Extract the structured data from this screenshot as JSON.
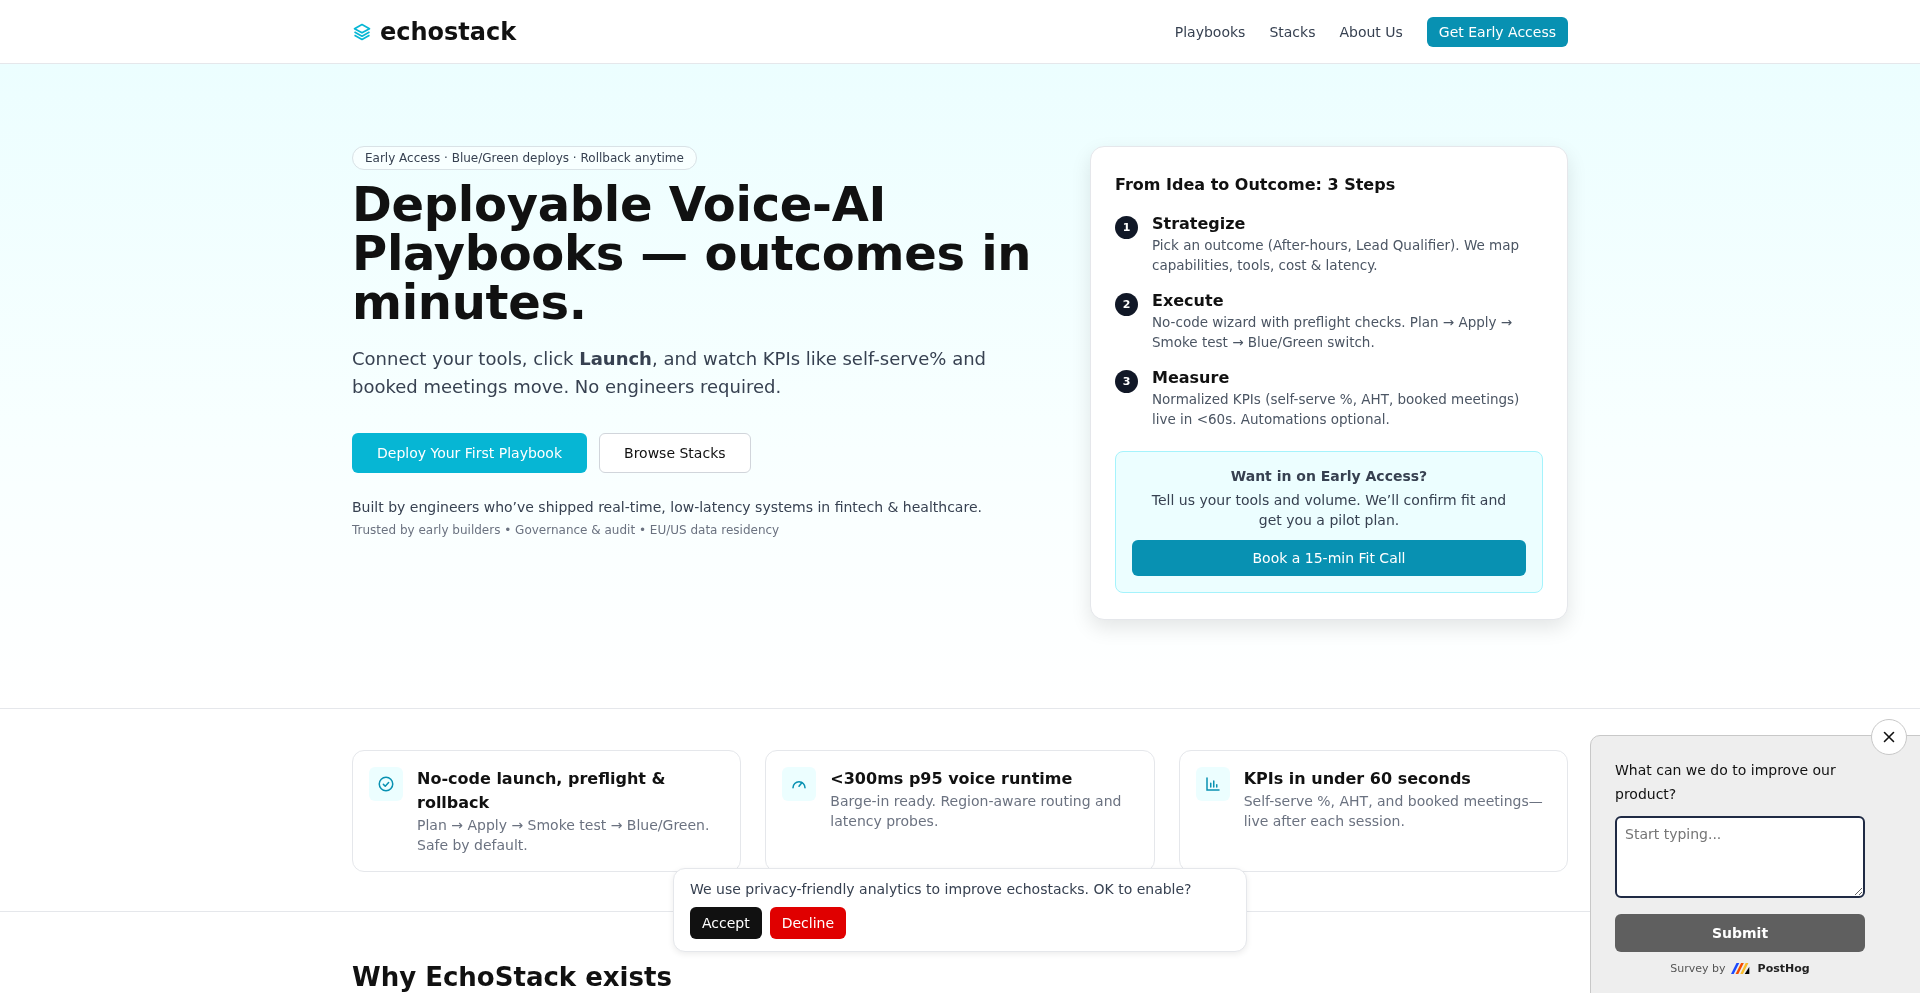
{
  "header": {
    "brand": "echostack",
    "nav": [
      {
        "label": "Playbooks",
        "kind": "link"
      },
      {
        "label": "Stacks",
        "kind": "link"
      },
      {
        "label": "About Us",
        "kind": "link"
      },
      {
        "label": "Get Early Access",
        "kind": "cta"
      }
    ]
  },
  "hero": {
    "badge": "Early Access · Blue/Green deploys · Rollback anytime",
    "title": "Deployable Voice-AI Playbooks — outcomes in minutes.",
    "lead": "Connect your tools, click **Launch**, and watch KPIs like self-serve% and booked meetings move. No engineers required.",
    "buttons": [
      {
        "label": "Deploy Your First Playbook",
        "kind": "primary"
      },
      {
        "label": "Browse Stacks",
        "kind": "secondary"
      }
    ],
    "note": "Built by engineers who’ve shipped real-time, low-latency systems in fintech & healthcare.",
    "trust": "Trusted by early builders • Governance & audit • EU/US data residency"
  },
  "steps_card": {
    "title": "From Idea to Outcome: 3 Steps",
    "steps": [
      {
        "number": "1",
        "title": "Strategize",
        "text": "Pick an outcome (After-hours, Lead Qualifier). We map capabilities, tools, cost & latency."
      },
      {
        "number": "2",
        "title": "Execute",
        "text": "No-code wizard with preflight checks. Plan → Apply → Smoke test → Blue/Green switch."
      },
      {
        "number": "3",
        "title": "Measure",
        "text": "Normalized KPIs (self-serve %, AHT, booked meetings) live in <60s. Automations optional."
      }
    ],
    "callout": {
      "title": "Want in on Early Access?",
      "text": "Tell us your tools and volume. We’ll confirm fit and get you a pilot plan.",
      "button": "Book a 15-min Fit Call"
    }
  },
  "features": [
    {
      "kind": "check",
      "title": "No-code launch, preflight & rollback",
      "text": "Plan → Apply → Smoke test → Blue/Green. Safe by default."
    },
    {
      "kind": "gauge",
      "title": "<300ms p95 voice runtime",
      "text": "Barge-in ready. Region-aware routing and latency probes."
    },
    {
      "kind": "chart",
      "title": "KPIs in under 60 seconds",
      "text": "Self-serve %, AHT, and booked meetings—live after each session."
    }
  ],
  "next_section": {
    "title": "Why EchoStack exists"
  },
  "cookie_banner": {
    "text": "We use privacy-friendly analytics to improve echostacks. OK to enable?",
    "buttons": [
      {
        "label": "Accept",
        "kind": "accept"
      },
      {
        "label": "Decline",
        "kind": "decline"
      }
    ]
  },
  "survey": {
    "question": "What can we do to improve our product?",
    "placeholder": "Start typing...",
    "button": "Submit",
    "credit": "Survey by",
    "brand": "PostHog"
  }
}
